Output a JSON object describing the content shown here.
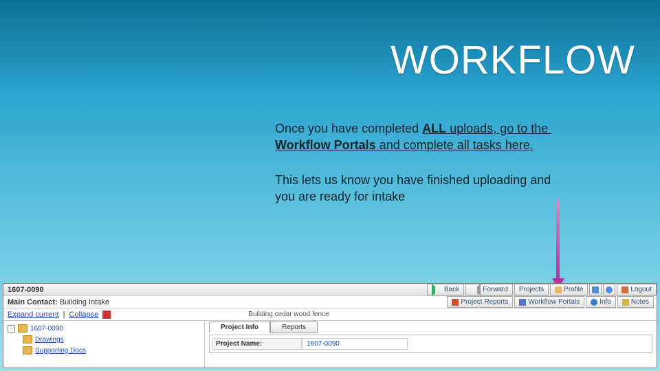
{
  "title": "WORKFLOW",
  "para1": [
    {
      "t": "Once you have completed "
    },
    {
      "t": "ALL",
      "b": true,
      "u": true
    },
    {
      "t": " uploads, go to the ",
      "u": true
    },
    {
      "t": "Workflow Portals",
      "b": true,
      "u": true
    },
    {
      "t": " and complete all tasks here.",
      "u": true
    }
  ],
  "para2": "This lets us know you have finished uploading and you are ready for intake",
  "panel": {
    "project_id": "1607-0090",
    "topbar": {
      "back": "Back",
      "forward": "Forward",
      "projects": "Projects",
      "profile": "Profile",
      "logout": "Logout"
    },
    "main_contact_label": "Main Contact:",
    "main_contact_value": "Building Intake",
    "row2_buttons": {
      "project_reports": "Project Reports",
      "workflow_portals": "Workflow Portals",
      "info": "Info",
      "notes": "Notes"
    },
    "tree_controls": {
      "expand": "Expand current",
      "collapse": "Collapse"
    },
    "building_note": "Building cedar wood fence",
    "tree": {
      "root": "1607-0090",
      "children": [
        "Drawings",
        "Supporting Docs"
      ]
    },
    "tabs": {
      "project_info": "Project Info",
      "reports": "Reports"
    },
    "field": {
      "label": "Project Name:",
      "value": "1607-0090"
    }
  }
}
